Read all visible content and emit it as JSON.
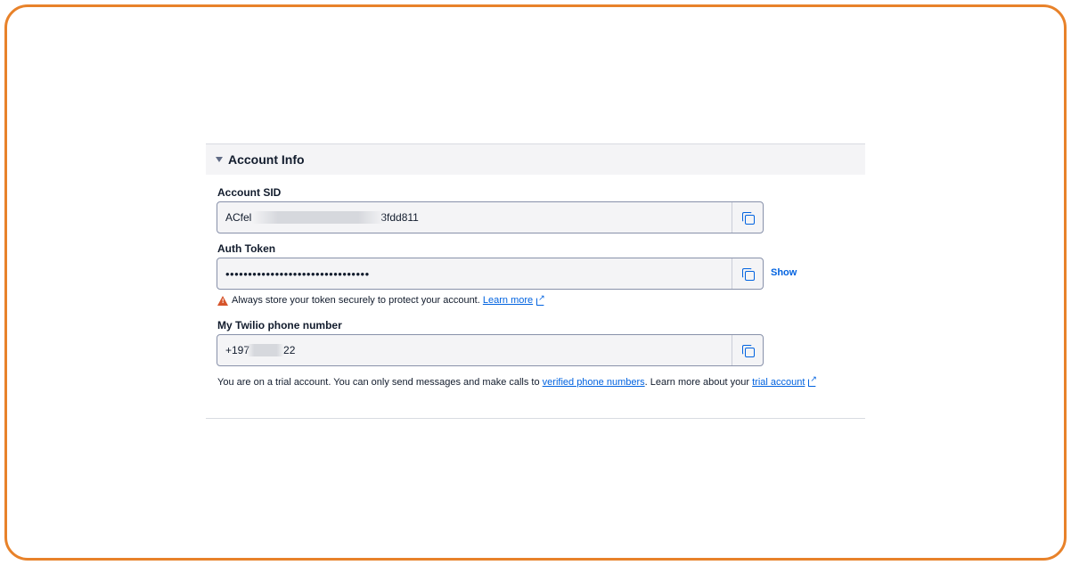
{
  "panel": {
    "title": "Account Info",
    "expanded": true
  },
  "account_sid": {
    "label": "Account SID",
    "value_prefix": "ACfel",
    "value_suffix": "3fdd811"
  },
  "auth_token": {
    "label": "Auth Token",
    "masked_value": "••••••••••••••••••••••••••••••••",
    "show_label": "Show"
  },
  "warning": {
    "text": "Always store your token securely to protect your account.",
    "link_text": "Learn more"
  },
  "phone": {
    "label": "My Twilio phone number",
    "value_prefix": "+197",
    "value_suffix": "22"
  },
  "trial_note": {
    "text_before": "You are on a trial account. You can only send messages and make calls to",
    "link1_text": "verified phone numbers",
    "text_middle": ". Learn more about your",
    "link2_text": "trial account"
  },
  "icons": {
    "copy": "copy-icon",
    "warning": "warning-triangle-icon",
    "external": "external-link-icon",
    "caret": "caret-down-icon"
  },
  "colors": {
    "accent": "#0263e0",
    "warning": "#d6542b",
    "frame_border": "#e8822a"
  }
}
